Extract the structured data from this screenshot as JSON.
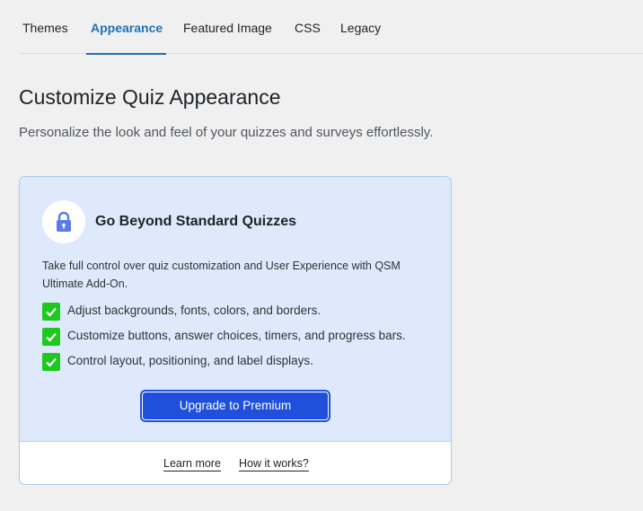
{
  "tabs": [
    {
      "label": "Themes",
      "active": false
    },
    {
      "label": "Appearance",
      "active": true
    },
    {
      "label": "Featured Image",
      "active": false
    },
    {
      "label": "CSS",
      "active": false
    },
    {
      "label": "Legacy",
      "active": false
    }
  ],
  "page": {
    "title": "Customize Quiz Appearance",
    "subtitle": "Personalize the look and feel of your quizzes and surveys effortlessly."
  },
  "promo": {
    "icon": "lock-icon",
    "heading": "Go Beyond Standard Quizzes",
    "description": "Take full control over quiz customization and User Experience with QSM Ultimate Add-On.",
    "features": [
      "Adjust backgrounds, fonts, colors, and borders.",
      "Customize buttons, answer choices, timers, and progress bars.",
      "Control layout, positioning, and label displays."
    ],
    "upgrade_label": "Upgrade to Premium",
    "links": {
      "learn_more": "Learn more",
      "how_it_works": "How it works?"
    }
  },
  "colors": {
    "accent": "#2271b1",
    "card_background": "#deeafb",
    "check": "#1ec81e",
    "button": "#1f4fdb"
  }
}
